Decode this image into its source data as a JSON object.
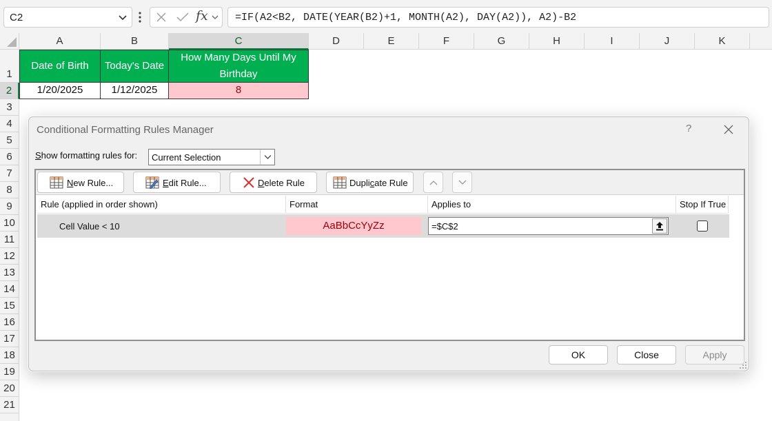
{
  "formula_bar": {
    "name_box": "C2",
    "formula": "=IF(A2<B2, DATE(YEAR(B2)+1, MONTH(A2), DAY(A2)), A2)-B2"
  },
  "sheet": {
    "columns": [
      "A",
      "B",
      "C",
      "D",
      "E",
      "F",
      "G",
      "H",
      "I",
      "J",
      "K"
    ],
    "rows": [
      "1",
      "2",
      "3",
      "4",
      "5",
      "6",
      "7",
      "8",
      "9",
      "10",
      "11",
      "12",
      "13",
      "14",
      "15",
      "16",
      "17",
      "18",
      "19",
      "20",
      "21"
    ],
    "selected_column": "C",
    "selected_row": "2",
    "header_row": [
      "Date of Birth",
      "Today's Date",
      "How Many Days Until My Birthday"
    ],
    "data_row": [
      "1/20/2025",
      "1/12/2025",
      "8"
    ],
    "header_fill": "#00b050",
    "highlight_fill": "#ffc7ce",
    "highlight_text": "#9c0006"
  },
  "dialog": {
    "title": "Conditional Formatting Rules Manager",
    "help": "?",
    "show_rules_label": "Show formatting rules for:",
    "show_rules_value": "Current Selection",
    "toolbar": {
      "new_rule": "New Rule...",
      "edit_rule": "Edit Rule...",
      "delete_rule": "Delete Rule",
      "duplicate_rule": "Duplicate Rule"
    },
    "columns": {
      "rule": "Rule (applied in order shown)",
      "format": "Format",
      "applies_to": "Applies to",
      "stop_if_true": "Stop If True"
    },
    "rules": [
      {
        "condition": "Cell Value < 10",
        "format_preview": "AaBbCcYyZz",
        "applies_to": "=$C$2",
        "stop_if_true": false
      }
    ],
    "buttons": {
      "ok": "OK",
      "close": "Close",
      "apply": "Apply"
    }
  }
}
